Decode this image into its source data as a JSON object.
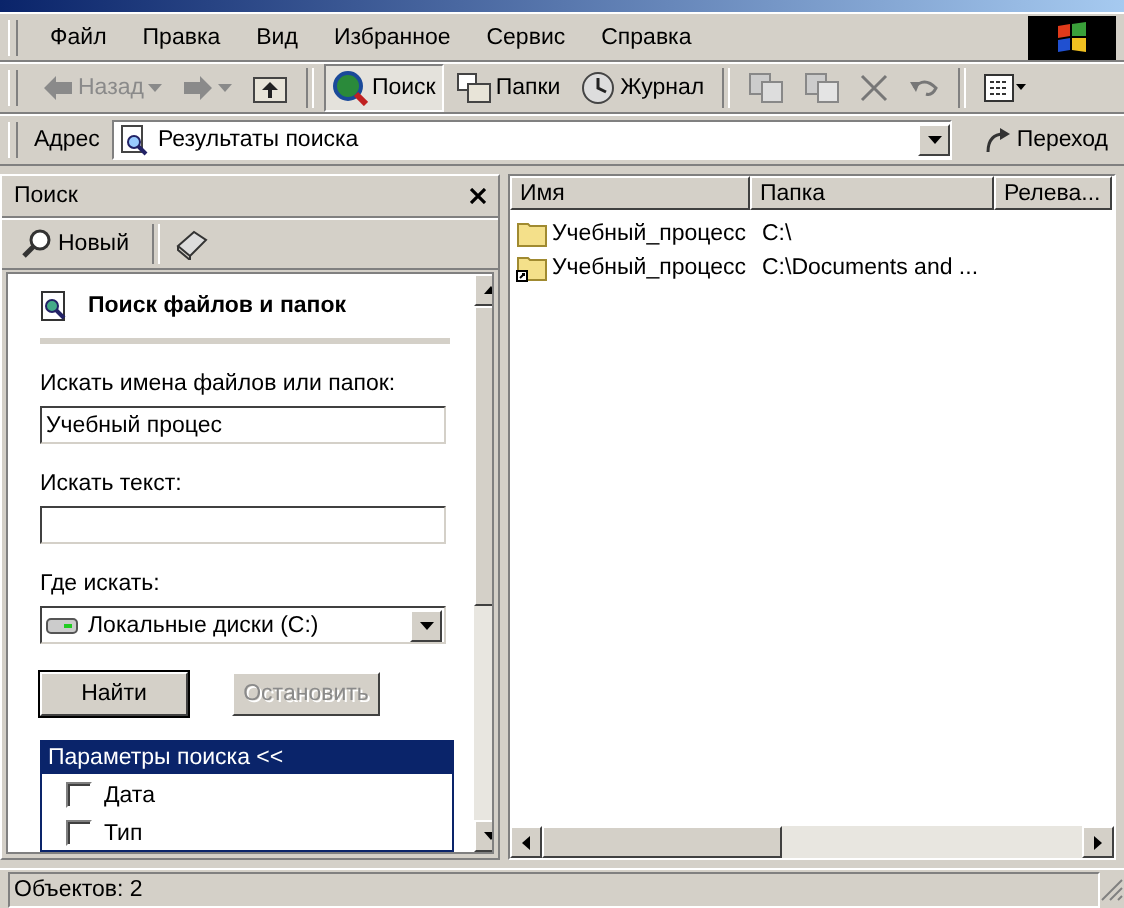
{
  "menu": [
    "Файл",
    "Правка",
    "Вид",
    "Избранное",
    "Сервис",
    "Справка"
  ],
  "toolbar": [
    {
      "kind": "back",
      "label": "Назад",
      "disabled": true
    },
    {
      "kind": "forward",
      "disabled": true
    },
    {
      "kind": "up"
    },
    {
      "kind": "sep"
    },
    {
      "kind": "search",
      "label": "Поиск",
      "selected": true
    },
    {
      "kind": "folders",
      "label": "Папки",
      "selected": false
    },
    {
      "kind": "history",
      "label": "Журнал",
      "selected": false
    },
    {
      "kind": "sep"
    },
    {
      "kind": "moveto"
    },
    {
      "kind": "copyto"
    },
    {
      "kind": "delete"
    },
    {
      "kind": "undo"
    },
    {
      "kind": "sep"
    },
    {
      "kind": "views"
    }
  ],
  "address": {
    "label": "Адрес",
    "value": "Результаты поиска",
    "go": "Переход"
  },
  "search_pane": {
    "title": "Поиск",
    "new_label": "Новый",
    "heading": "Поиск файлов и папок",
    "fields": [
      {
        "kind": "text",
        "label": "Искать имена файлов или папок:",
        "value": "Учебный процес"
      },
      {
        "kind": "text",
        "label": "Искать текст:"
      },
      {
        "kind": "select",
        "label": "Где искать:",
        "value": "Локальные диски (C:)"
      }
    ],
    "buttons": [
      {
        "label": "Найти",
        "disabled": false
      },
      {
        "label": "Остановить",
        "disabled": true
      }
    ],
    "options_header": "Параметры поиска  <<",
    "options": [
      {
        "label": "Дата",
        "checked": false
      },
      {
        "label": "Тип",
        "checked": false
      }
    ]
  },
  "results": {
    "columns": [
      "Имя",
      "Папка",
      "Релева..."
    ],
    "rows": [
      {
        "kind": "folder",
        "name": "Учебный_процесс",
        "folder": "C:\\"
      },
      {
        "kind": "shortcut",
        "name": "Учебный_процесс",
        "folder": "C:\\Documents and ..."
      }
    ]
  },
  "status_bar": "Объектов: 2"
}
